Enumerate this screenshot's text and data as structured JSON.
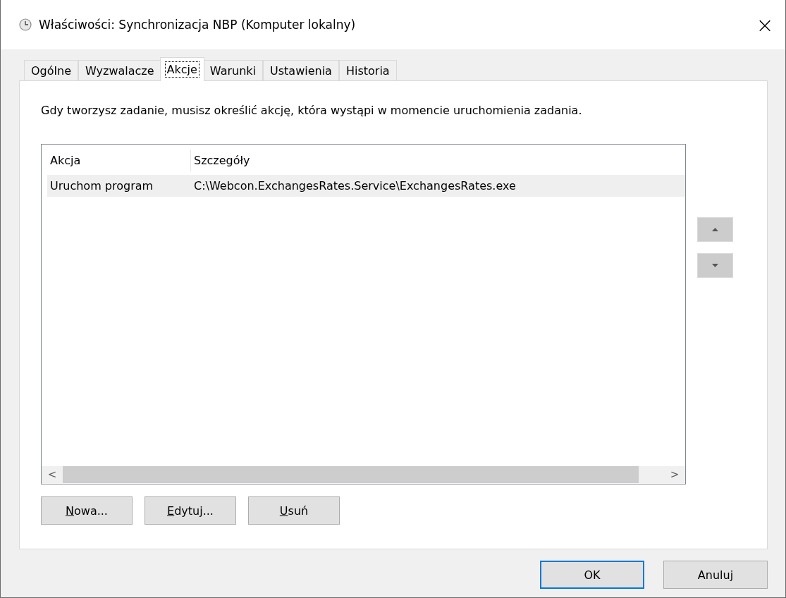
{
  "window": {
    "title": "Właściwości: Synchronizacja NBP (Komputer lokalny)",
    "close": "×"
  },
  "tabs": [
    {
      "label": "Ogólne",
      "selected": false
    },
    {
      "label": "Wyzwalacze",
      "selected": false
    },
    {
      "label": "Akcje",
      "selected": true
    },
    {
      "label": "Warunki",
      "selected": false
    },
    {
      "label": "Ustawienia",
      "selected": false
    },
    {
      "label": "Historia",
      "selected": false
    }
  ],
  "description": "Gdy tworzysz zadanie, musisz określić akcję, która wystąpi w momencie uruchomienia zadania.",
  "table": {
    "columns": [
      "Akcja",
      "Szczegóły"
    ],
    "rows": [
      {
        "cells": [
          "Uruchom program",
          "C:\\Webcon.ExchangesRates.Service\\ExchangesRates.exe"
        ],
        "selected": true
      }
    ],
    "scroll_left": "<",
    "scroll_right": ">"
  },
  "action_buttons": [
    {
      "access_key": "N",
      "rest": "owa..."
    },
    {
      "access_key": "E",
      "rest": "dytuj..."
    },
    {
      "access_key": "U",
      "rest": "suń"
    }
  ],
  "dialog_buttons": [
    {
      "label": "OK",
      "default": true
    },
    {
      "label": "Anuluj",
      "default": false
    }
  ]
}
